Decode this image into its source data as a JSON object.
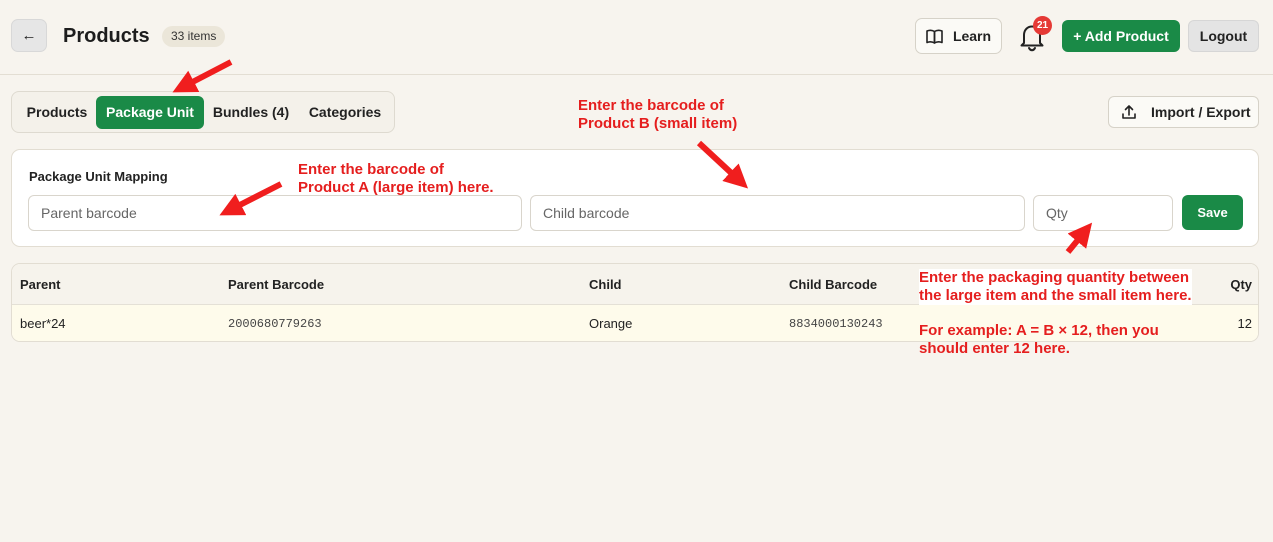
{
  "header": {
    "back_label": "←",
    "title": "Products",
    "count_label": "33 items",
    "learn_label": "Learn",
    "notification_count": "21",
    "add_product_label": "+ Add Product",
    "logout_label": "Logout"
  },
  "tabs": [
    {
      "label": "Products",
      "active": false
    },
    {
      "label": "Package Unit",
      "active": true
    },
    {
      "label": "Bundles (4)",
      "active": false
    },
    {
      "label": "Categories",
      "active": false
    }
  ],
  "import_export_label": "Import / Export",
  "mapping": {
    "title": "Package Unit Mapping",
    "parent_placeholder": "Parent barcode",
    "child_placeholder": "Child barcode",
    "qty_placeholder": "Qty",
    "save_label": "Save"
  },
  "table": {
    "columns": [
      "Parent",
      "Parent Barcode",
      "Child",
      "Child Barcode",
      "Qty"
    ],
    "rows": [
      {
        "parent": "beer*24",
        "parent_barcode": "2000680779263",
        "child": "Orange",
        "child_barcode": "8834000130243",
        "qty": "12"
      }
    ]
  },
  "annotations": {
    "product_a": "Enter the barcode of\nProduct A (large item) here.",
    "product_b": "Enter the barcode of\nProduct B (small item)",
    "qty_note": "Enter the packaging quantity between\nthe large item and the small item here.",
    "example_note": "For example: A = B × 12, then you\nshould enter 12 here."
  },
  "colors": {
    "accent_green": "#1a8a47",
    "annotation_red": "#e51e1e",
    "badge_red": "#e53935"
  }
}
